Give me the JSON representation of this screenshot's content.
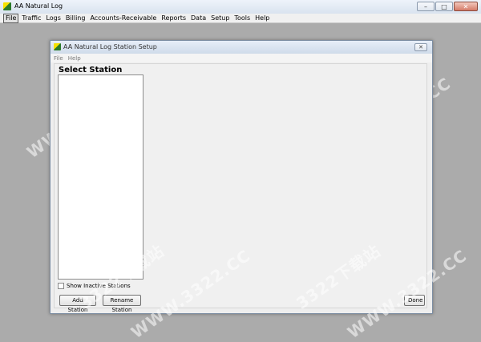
{
  "window": {
    "title": "AA Natural Log",
    "minimize": "–",
    "maximize": "□",
    "close": "✕"
  },
  "menubar": [
    {
      "label": "File",
      "active": true
    },
    {
      "label": "Traffic"
    },
    {
      "label": "Logs"
    },
    {
      "label": "Billing"
    },
    {
      "label": "Accounts-Receivable"
    },
    {
      "label": "Reports"
    },
    {
      "label": "Data"
    },
    {
      "label": "Setup"
    },
    {
      "label": "Tools"
    },
    {
      "label": "Help"
    }
  ],
  "dialog": {
    "title": "AA Natural Log Station Setup",
    "close": "✕",
    "menu": [
      "File",
      "Help"
    ],
    "heading": "Select Station",
    "stations": [],
    "show_inactive_label": "Show Inactive Stations",
    "show_inactive_checked": false,
    "add_label": "Add Station",
    "rename_label": "Rename Station",
    "done_label": "Done"
  },
  "watermark": {
    "url_text": "WWW.3322.CC",
    "cn_text": "3322下载站"
  }
}
